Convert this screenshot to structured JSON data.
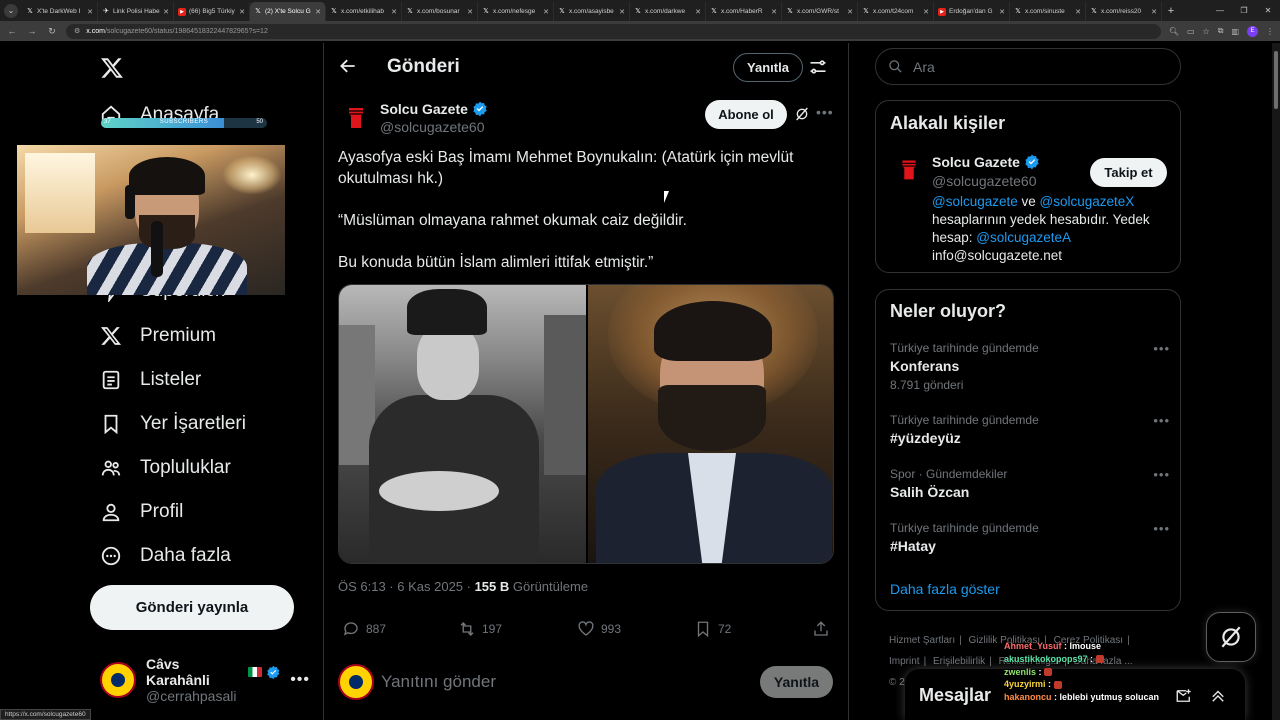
{
  "browser": {
    "tabs": [
      {
        "label": "X'te DarkWeb I",
        "icon": "x-icon",
        "active": false
      },
      {
        "label": "Link Polisi Habe",
        "icon": "bird-icon",
        "active": false
      },
      {
        "label": "(66) Big5 Türkiy",
        "icon": "youtube-icon",
        "active": false
      },
      {
        "label": "(2) X'te Solcu G",
        "icon": "x-icon",
        "active": true
      },
      {
        "label": "x.com/etkilihab",
        "icon": "x-icon",
        "active": false
      },
      {
        "label": "x.com/bosunar",
        "icon": "x-icon",
        "active": false
      },
      {
        "label": "x.com/nefesge",
        "icon": "x-icon",
        "active": false
      },
      {
        "label": "x.com/asayisbe",
        "icon": "x-icon",
        "active": false
      },
      {
        "label": "x.com/darkwe",
        "icon": "x-icon",
        "active": false
      },
      {
        "label": "x.com/HaberR",
        "icon": "x-icon",
        "active": false
      },
      {
        "label": "x.com/GWR/st",
        "icon": "x-icon",
        "active": false
      },
      {
        "label": "x.com/t24com",
        "icon": "x-icon",
        "active": false
      },
      {
        "label": "Erdoğan'dan G",
        "icon": "youtube-icon",
        "active": false
      },
      {
        "label": "x.com/sinuste",
        "icon": "x-icon",
        "active": false
      },
      {
        "label": "x.com/reiss20",
        "icon": "x-icon",
        "active": false
      }
    ],
    "url_host": "x.com",
    "url_path": "/solcugazete60/status/1986451832244782965?s=12",
    "status_url": "https://x.com/solcugazete60",
    "profile_initial": "E"
  },
  "sidebar": {
    "items": [
      {
        "label": "Anasayfa",
        "icon": "home-icon"
      },
      {
        "label": "Superdick",
        "icon": "lightning-icon"
      },
      {
        "label": "Premium",
        "icon": "x-icon"
      },
      {
        "label": "Listeler",
        "icon": "list-icon"
      },
      {
        "label": "Yer İşaretleri",
        "icon": "bookmark-icon"
      },
      {
        "label": "Topluluklar",
        "icon": "communities-icon"
      },
      {
        "label": "Profil",
        "icon": "profile-icon"
      },
      {
        "label": "Daha fazla",
        "icon": "more-circle-icon"
      }
    ],
    "post_button": "Gönderi yayınla",
    "account": {
      "name": "Câvs Karahânli",
      "handle": "@cerrahpasali"
    }
  },
  "stream_overlay": {
    "sub_bar": {
      "current": "37",
      "label": "SUBSCRIBERS",
      "goal": "50",
      "progress": 0.74
    }
  },
  "header": {
    "title": "Gönderi",
    "reply_button": "Yanıtla"
  },
  "post": {
    "author_name": "Solcu Gazete",
    "author_handle": "@solcugazete60",
    "subscribe_button": "Abone ol",
    "paragraphs": [
      "Ayasofya eski Baş İmamı Mehmet Boynukalın: (Atatürk için mevlüt okutulması hk.)",
      "“Müslüman olmayana rahmet okumak caiz değildir.",
      "Bu konuda bütün İslam alimleri ittifak etmiştir.”"
    ],
    "time": "ÖS 6:13 · 6 Kas 2025 · ",
    "views_count": "155 B",
    "views_label": " Görüntüleme",
    "actions": {
      "replies": "887",
      "reposts": "197",
      "likes": "993",
      "bookmarks": "72"
    },
    "reply_placeholder": "Yanıtını gönder",
    "reply_button": "Yanıtla"
  },
  "search": {
    "placeholder": "Ara"
  },
  "related": {
    "title": "Alakalı kişiler",
    "name": "Solcu Gazete",
    "handle": "@solcugazete60",
    "follow_button": "Takip et",
    "bio_link1": "@solcugazete",
    "bio_mid": " ve ",
    "bio_link2": "@solcugazeteX",
    "bio_text1": " hesaplarının yedek hesabıdır. Yedek hesap: ",
    "bio_link3": "@solcugazeteA",
    "bio_email": "info@solcugazete.net"
  },
  "trends": {
    "title": "Neler oluyor?",
    "items": [
      {
        "category": "Türkiye tarihinde gündemde",
        "name": "Konferans",
        "count": "8.791 gönderi"
      },
      {
        "category": "Türkiye tarihinde gündemde",
        "name": "#yüzdeyüz",
        "count": ""
      },
      {
        "category": "Spor · Gündemdekiler",
        "name": "Salih Özcan",
        "count": ""
      },
      {
        "category": "Türkiye tarihinde gündemde",
        "name": "#Hatay",
        "count": ""
      }
    ],
    "show_more": "Daha fazla göster"
  },
  "footer": {
    "links": [
      "Hizmet Şartları",
      "|",
      "Gizlilik Politikası",
      "|",
      "Çerez Politikası",
      "|",
      "Imprint",
      "|",
      "Erişilebilirlik",
      "|",
      "Reklam bilgisi",
      "|",
      "Daha fazla ...",
      "© 2025 X C"
    ]
  },
  "messages": {
    "title": "Mesajlar"
  },
  "chat": [
    {
      "user": "Ahmet_Yusuf",
      "text": "lmouse"
    },
    {
      "user": "akustikkokopops97",
      "text": ""
    },
    {
      "user": "zwenlis",
      "text": ""
    },
    {
      "user": "4yuzyirmi",
      "text": ""
    },
    {
      "user": "hakanoncu",
      "text": "leblebi yutmuş solucan"
    }
  ],
  "colors": {
    "accent": "#1d9bf0",
    "verified": "#1d9bf0",
    "background": "#000000",
    "border": "#2f3336"
  }
}
